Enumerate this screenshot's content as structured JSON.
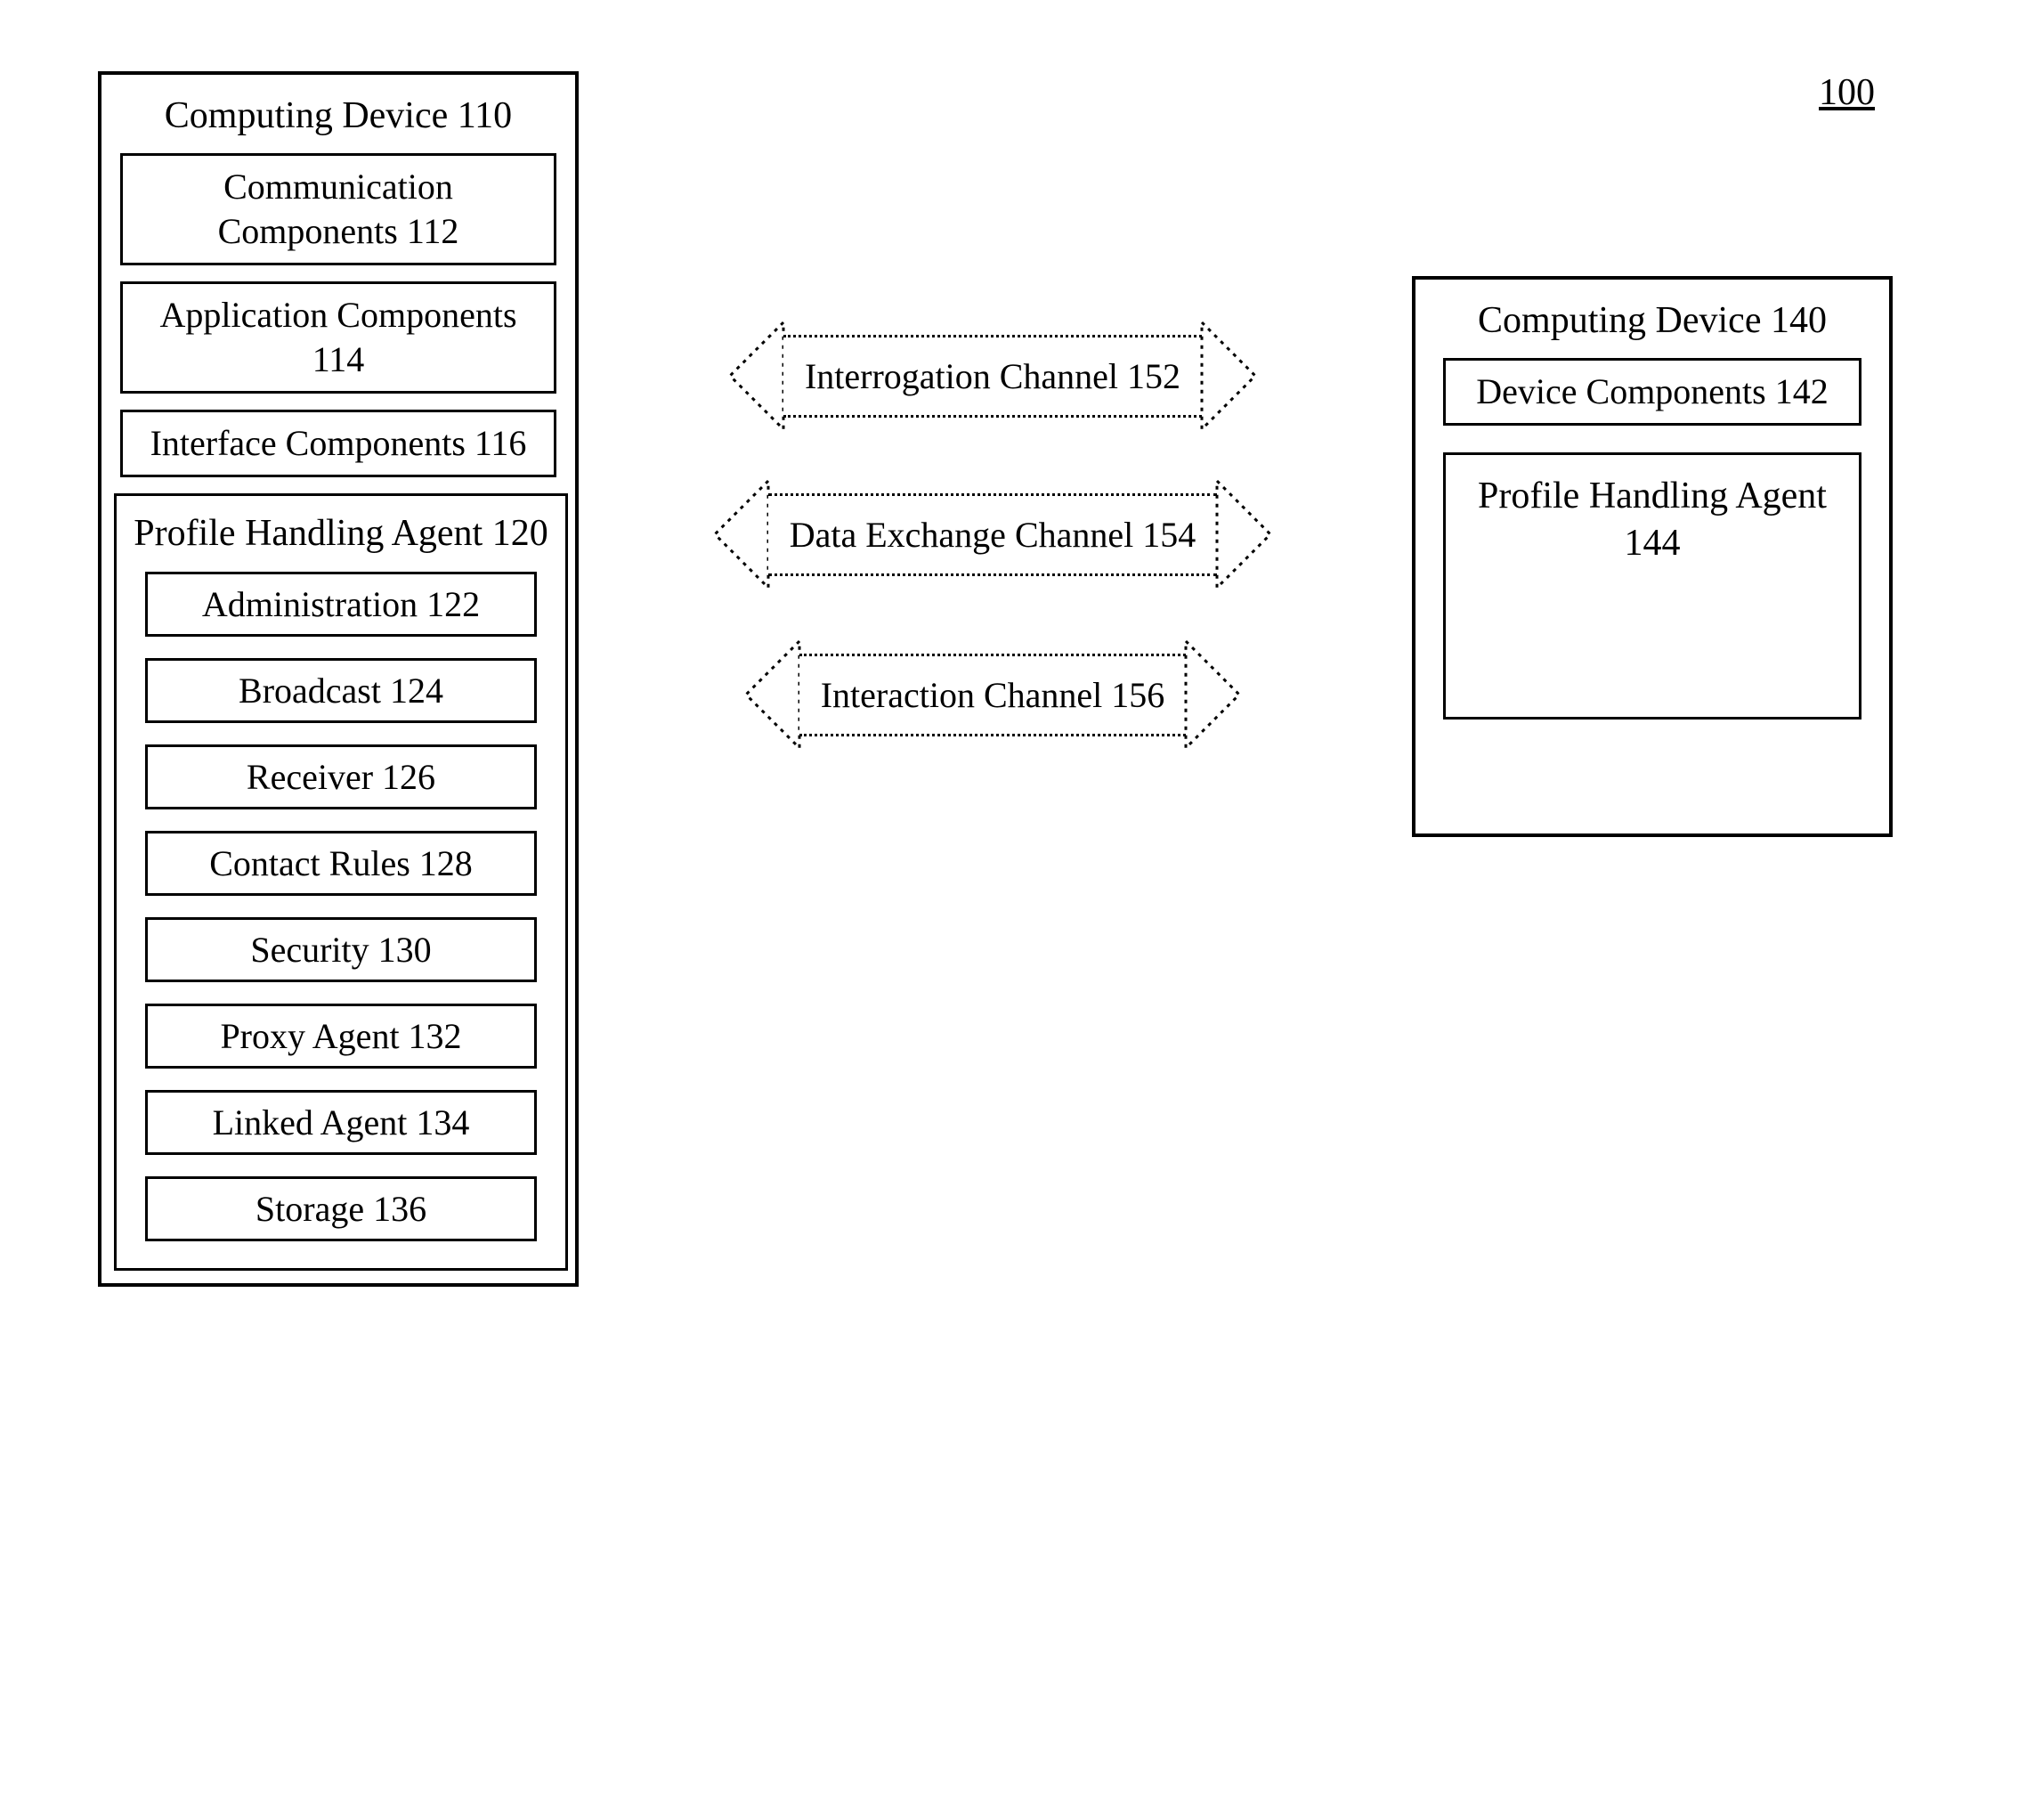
{
  "figure_number": "100",
  "device_110": {
    "title": "Computing Device 110",
    "components": [
      "Communication Components 112",
      "Application Components 114",
      "Interface Components 116"
    ],
    "agent": {
      "title": "Profile Handling Agent 120",
      "sub": [
        "Administration 122",
        "Broadcast 124",
        "Receiver 126",
        "Contact Rules 128",
        "Security 130",
        "Proxy Agent 132",
        "Linked Agent 134",
        "Storage 136"
      ]
    }
  },
  "device_140": {
    "title": "Computing Device 140",
    "components": [
      "Device Components 142"
    ],
    "agent_title": "Profile Handling Agent 144"
  },
  "channels": {
    "c152": "Interrogation Channel 152",
    "c154": "Data Exchange Channel 154",
    "c156": "Interaction Channel 156"
  }
}
